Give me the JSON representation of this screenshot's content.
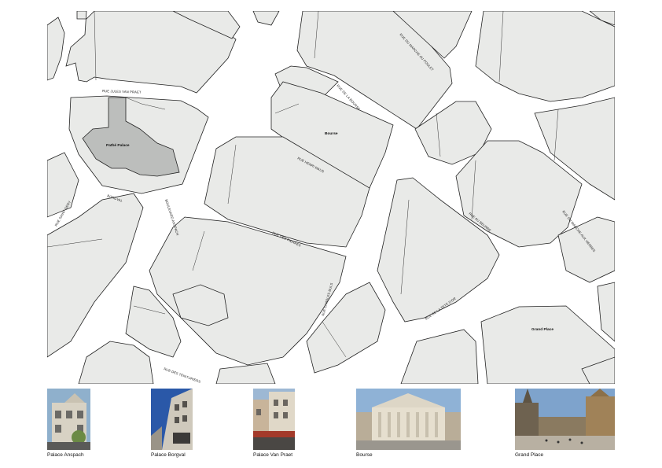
{
  "map": {
    "streets": [
      "RUE JULES VAN PRAET",
      "RUE DE LA BOURSE",
      "RUE DU MARCHE AU POULET",
      "RUE HENRI MAUS",
      "BORGVAL",
      "RUE SAINT-GERY",
      "BOULEVARD ANSPACH",
      "RUE DES PIERRES",
      "RUE AU BEURRE",
      "RUE DU MARCHE AUX HERBES",
      "RUE CHARLES BULS",
      "RUE DE LA TETE D'OR",
      "RUE DES TEINTURIERS"
    ],
    "places": {
      "pathe": "Pathé Palace",
      "bourse": "Bourse",
      "grand_place": "Grand Place"
    }
  },
  "photos": [
    {
      "caption": "Palace Anspach"
    },
    {
      "caption": "Palace Borgval"
    },
    {
      "caption": "Palace Van Praet"
    },
    {
      "caption": "Bourse"
    },
    {
      "caption": "Grand Place"
    }
  ],
  "colors": {
    "block_fill": "#e9eae8",
    "highlight_fill": "#bcbebc",
    "outline": "#222222"
  }
}
